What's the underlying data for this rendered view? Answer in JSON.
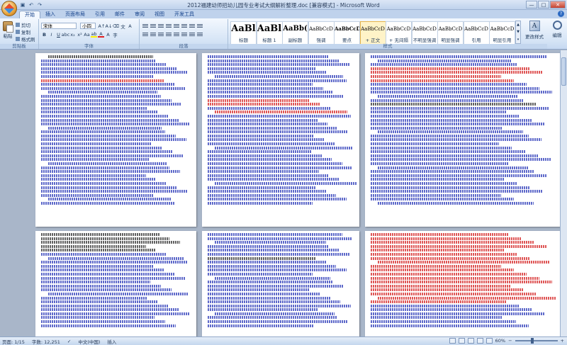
{
  "window": {
    "title": "2012福建幼师招幼儿园专业考试大纲解析整理.doc [兼容模式] - Microsoft Word",
    "minimize": "—",
    "maximize": "□",
    "close": "✕"
  },
  "tabs": [
    "开始",
    "插入",
    "页面布局",
    "引用",
    "邮件",
    "审阅",
    "视图",
    "开发工具"
  ],
  "clipboard": {
    "paste_label": "粘贴",
    "cut_label": "剪切",
    "copy_label": "复制",
    "painter_label": "格式刷",
    "group_label": "剪贴板"
  },
  "font": {
    "name": "宋体",
    "size": "小四",
    "group_label": "字体"
  },
  "paragraph": {
    "group_label": "段落"
  },
  "styles": {
    "group_label": "样式",
    "items": [
      {
        "sample": "AaBl",
        "name": "标题",
        "size": "13px",
        "bold": true
      },
      {
        "sample": "AaBl",
        "name": "标题 1",
        "size": "13px",
        "bold": true
      },
      {
        "sample": "AaBb(",
        "name": "副标题",
        "size": "10px",
        "bold": true
      },
      {
        "sample": "AaBbCcD",
        "name": "强调",
        "size": "7px",
        "bold": false
      },
      {
        "sample": "AaBbCcD",
        "name": "要点",
        "size": "7px",
        "bold": true
      },
      {
        "sample": "AaBbCcD",
        "name": "+ 正文",
        "size": "7px",
        "bold": false,
        "selected": true
      },
      {
        "sample": "AaBbCcD",
        "name": "+ 无间隔",
        "size": "7px",
        "bold": false
      },
      {
        "sample": "AaBbCcD",
        "name": "不明显强调",
        "size": "7px",
        "bold": false
      },
      {
        "sample": "AaBbCcD",
        "name": "明显强调",
        "size": "7px",
        "bold": false
      },
      {
        "sample": "AaBbCcD",
        "name": "引用",
        "size": "7px",
        "bold": false
      },
      {
        "sample": "AaBbCcD",
        "name": "明显引用",
        "size": "7px",
        "bold": false
      }
    ]
  },
  "change_styles_label": "更改样式",
  "editing_label": "编辑",
  "status": {
    "page": "页面: 1/15",
    "words": "字数: 12,251",
    "language": "中文(中国)",
    "mode": "插入",
    "zoom": "60%"
  }
}
